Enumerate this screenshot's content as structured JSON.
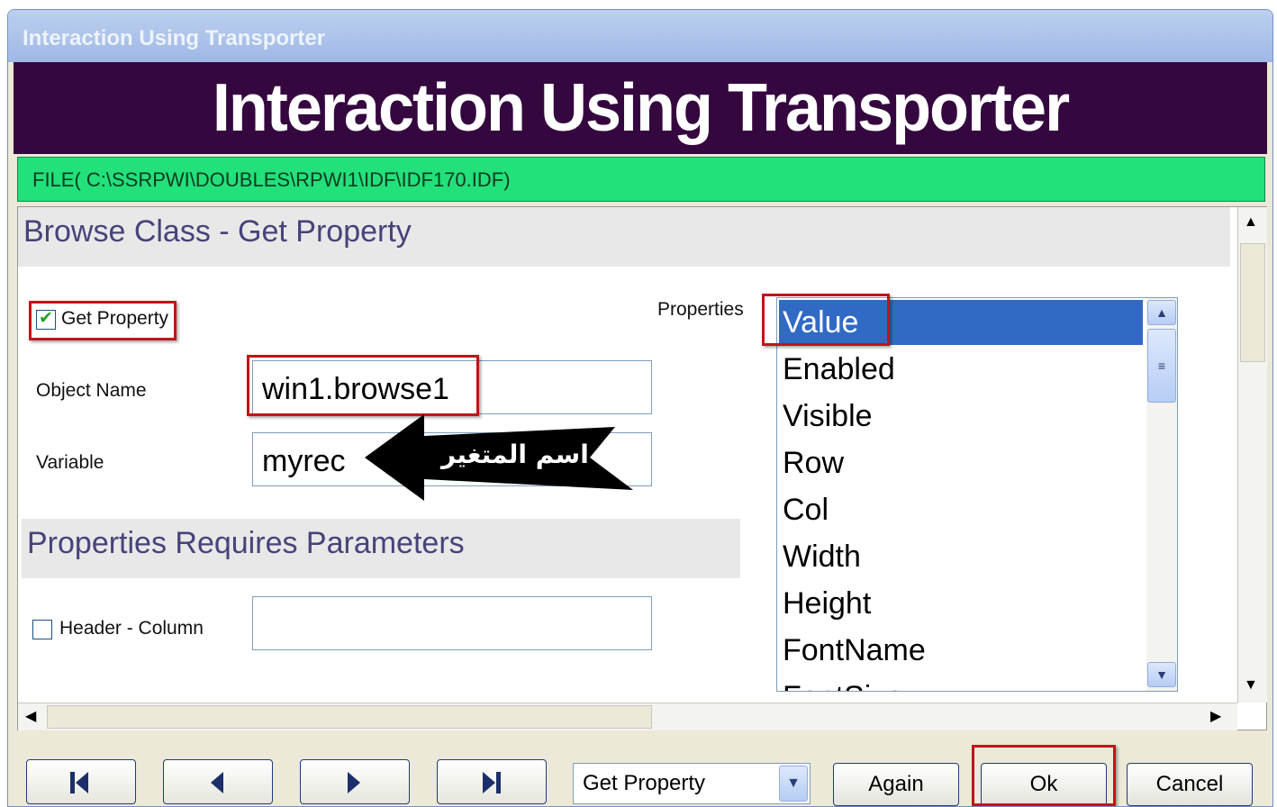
{
  "window": {
    "title": "Interaction Using Transporter"
  },
  "banner": {
    "text": "Interaction Using Transporter"
  },
  "file_path": "FILE( C:\\SSRPWI\\DOUBLES\\RPWI1\\IDF\\IDF170.IDF)",
  "section1": {
    "title": "Browse Class - Get Property"
  },
  "get_property": {
    "label": "Get Property",
    "checked": true
  },
  "object_name": {
    "label": "Object Name",
    "value": "win1.browse1"
  },
  "variable": {
    "label": "Variable",
    "value": "myrec"
  },
  "callout": {
    "text": "اسم المتغير"
  },
  "section2": {
    "title": "Properties Requires Parameters"
  },
  "header_column": {
    "label": "Header - Column",
    "checked": false,
    "value": ""
  },
  "properties": {
    "label": "Properties",
    "items": [
      "Value",
      "Enabled",
      "Visible",
      "Row",
      "Col",
      "Width",
      "Height",
      "FontName",
      "FontSize"
    ],
    "selected": "Value"
  },
  "toolbar": {
    "first_icon": "first-record-icon",
    "prev_icon": "previous-record-icon",
    "next_icon": "next-record-icon",
    "last_icon": "last-record-icon",
    "mode_value": "Get Property",
    "again_label": "Again",
    "ok_label": "Ok",
    "cancel_label": "Cancel"
  },
  "colors": {
    "banner": "#35073f",
    "filebar": "#22e07a",
    "selection": "#316ac5",
    "highlight": "#c0141a"
  }
}
